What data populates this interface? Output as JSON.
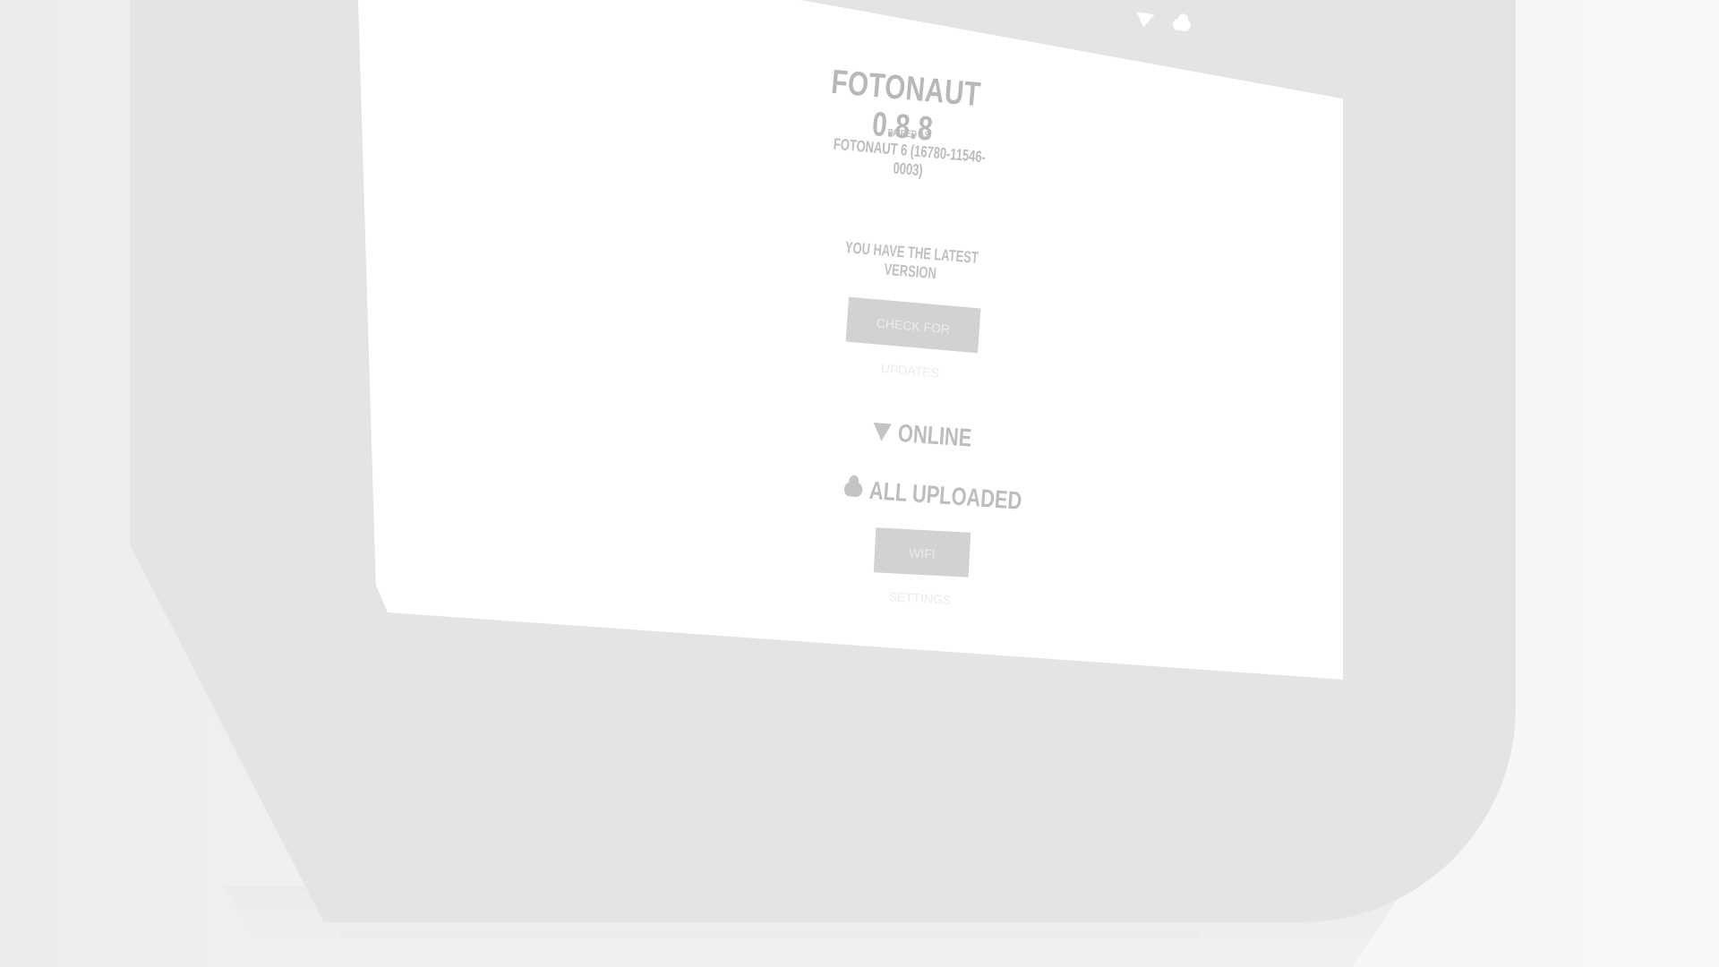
{
  "device": {
    "app_title": "FOTONAUT 0.8.8",
    "paired_label": "PAIRED AS",
    "paired_name": "FOTONAUT 6 (16780-11546-0003)",
    "version_status": "YOU HAVE THE LATEST VERSION",
    "check_updates_label": "CHECK FOR UPDATES",
    "online_label": "ONLINE",
    "upload_label": "ALL UPLOADED",
    "wifi_settings_label": "WIFI SETTINGS"
  },
  "status_bar": {
    "icons": [
      "wifi-icon",
      "cloud-upload-icon"
    ]
  },
  "colors": {
    "bezel": "#e4e4e4",
    "screen": "#ffffff",
    "text": "#bdbdbd",
    "button": "#d2d2d2"
  }
}
